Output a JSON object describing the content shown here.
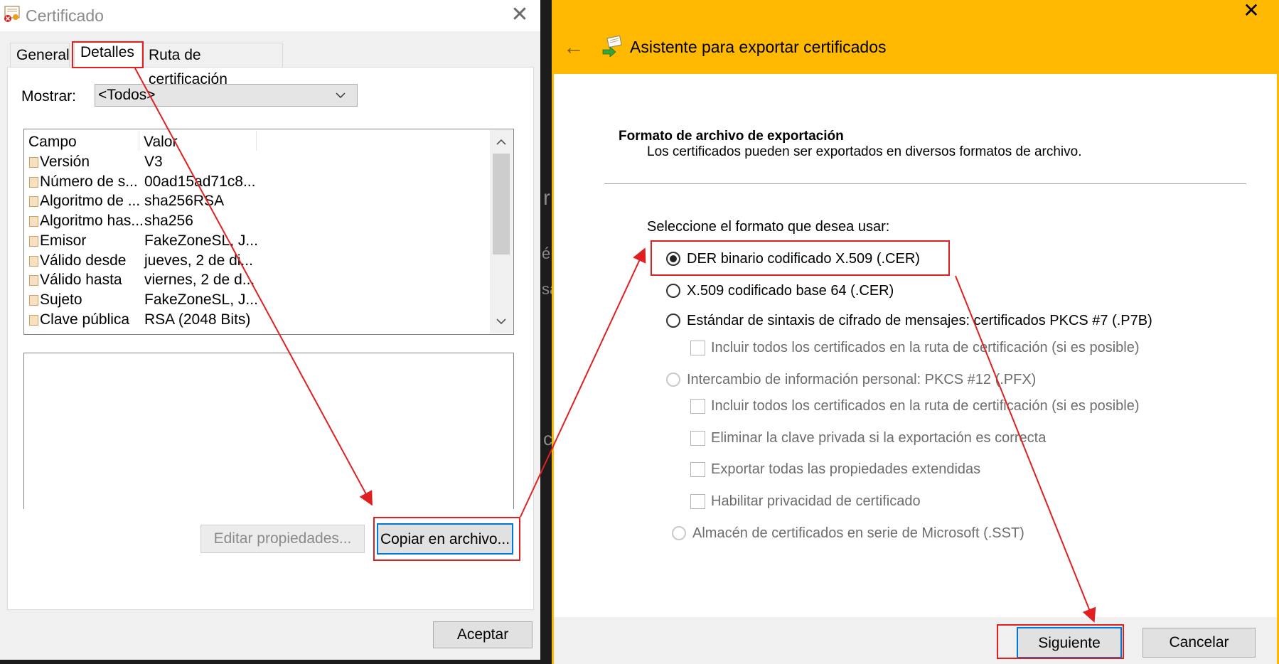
{
  "left_window": {
    "title": "Certificado",
    "close_glyph": "✕",
    "tabs": [
      {
        "label": "General"
      },
      {
        "label": "Detalles"
      },
      {
        "label": "Ruta de certificación"
      }
    ],
    "show_label": "Mostrar:",
    "show_value": "<Todos>",
    "columns": [
      "Campo",
      "Valor"
    ],
    "rows": [
      {
        "field": "Versión",
        "value": "V3"
      },
      {
        "field": "Número de s...",
        "value": "00ad15ad71c8..."
      },
      {
        "field": "Algoritmo de ...",
        "value": "sha256RSA"
      },
      {
        "field": "Algoritmo has...",
        "value": "sha256"
      },
      {
        "field": "Emisor",
        "value": "FakeZoneSL, J..."
      },
      {
        "field": "Válido desde",
        "value": "jueves, 2 de di..."
      },
      {
        "field": "Válido hasta",
        "value": "viernes, 2 de d..."
      },
      {
        "field": "Sujeto",
        "value": "FakeZoneSL, J..."
      },
      {
        "field": "Clave pública",
        "value": "RSA (2048 Bits)"
      }
    ],
    "edit_button": "Editar propiedades...",
    "copy_button": "Copiar en archivo...",
    "accept_button": "Aceptar",
    "icons": {
      "app": "certificate-icon",
      "row": "field-icon"
    }
  },
  "right_window": {
    "close_glyph": "✕",
    "back_glyph": "←",
    "title": "Asistente para exportar certificados",
    "section_title": "Formato de archivo de exportación",
    "section_desc": "Los certificados pueden ser exportados en diversos formatos de archivo.",
    "select_prompt": "Seleccione el formato que desea usar:",
    "options": [
      {
        "label": "DER binario codificado X.509 (.CER)",
        "selected": true,
        "enabled": true
      },
      {
        "label": "X.509 codificado base 64 (.CER)",
        "selected": false,
        "enabled": true
      },
      {
        "label": "Estándar de sintaxis de cifrado de mensajes: certificados PKCS #7 (.P7B)",
        "selected": false,
        "enabled": true
      },
      {
        "label": "Intercambio de información personal: PKCS #12 (.PFX)",
        "selected": false,
        "enabled": false
      },
      {
        "label": "Almacén de certificados en serie de Microsoft (.SST)",
        "selected": false,
        "enabled": false
      }
    ],
    "checkboxes": [
      {
        "label": "Incluir todos los certificados en la ruta de certificación (si es posible)"
      },
      {
        "label": "Incluir todos los certificados en la ruta de certificación (si es posible)"
      },
      {
        "label": "Eliminar la clave privada si la exportación es correcta"
      },
      {
        "label": "Exportar todas las propiedades extendidas"
      },
      {
        "label": "Habilitar privacidad de certificado"
      }
    ],
    "next_button": "Siguiente",
    "cancel_button": "Cancelar",
    "accent_color": "#ffb900",
    "icons": {
      "wizard": "certificate-export-icon"
    }
  },
  "background_fragments": [
    "r",
    "é",
    "sa",
    "c"
  ],
  "annotation_color": "#e02020"
}
